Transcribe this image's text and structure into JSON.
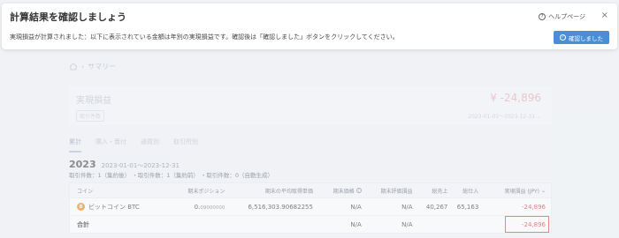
{
  "modal": {
    "title": "計算結果を確認しましょう",
    "message": "実現損益が計算されました：以下に表示されている金額は年別の実現損益です。確認後は「確認しました」ボタンをクリックしてください。",
    "help_label": "ヘルプページ",
    "close_symbol": "×",
    "confirm_label": "確認しました"
  },
  "breadcrumb": {
    "separator": "›",
    "current": "サマリー"
  },
  "summary": {
    "title": "実現損益",
    "badge": "取引件数",
    "amount": "¥ -24,896",
    "period": "2023-01-01〜2023-12-31"
  },
  "tabs": [
    {
      "label": "累計"
    },
    {
      "label": "購入・賣付"
    },
    {
      "label": "通貨別"
    },
    {
      "label": "取引所別"
    }
  ],
  "year_section": {
    "year": "2023",
    "range": "2023-01-01〜2023-12-31",
    "counts": "取引件数：1（集約後） ・取引件数：1（集約前） ・取引件数：0（自動生成）"
  },
  "table": {
    "headers": {
      "coin": "コイン",
      "position": "期末ポジション",
      "avg_cost": "期末の平均取得単価",
      "price": "期末価格",
      "valuation": "期末評価損益",
      "total_sales": "総売上",
      "total_cost": "総仕入",
      "realized_pnl": "実現損益 (JPY)"
    },
    "rows": [
      {
        "coin_icon": "B",
        "coin_name": "ビットコイン BTC",
        "position": "0.",
        "position_small": "09000000",
        "avg_cost": "6,516,303.90682255",
        "price": "N/A",
        "valuation": "N/A",
        "total_sales": "40,267",
        "total_cost": "65,163",
        "realized_pnl": "-24,896"
      }
    ],
    "total": {
      "label": "合計",
      "price": "N/A",
      "valuation": "N/A",
      "realized_pnl": "-24,896"
    }
  },
  "colors": {
    "accent": "#4a8fd6",
    "negative": "#e04848",
    "highlight": "#e05050",
    "btc": "#f7931a"
  }
}
